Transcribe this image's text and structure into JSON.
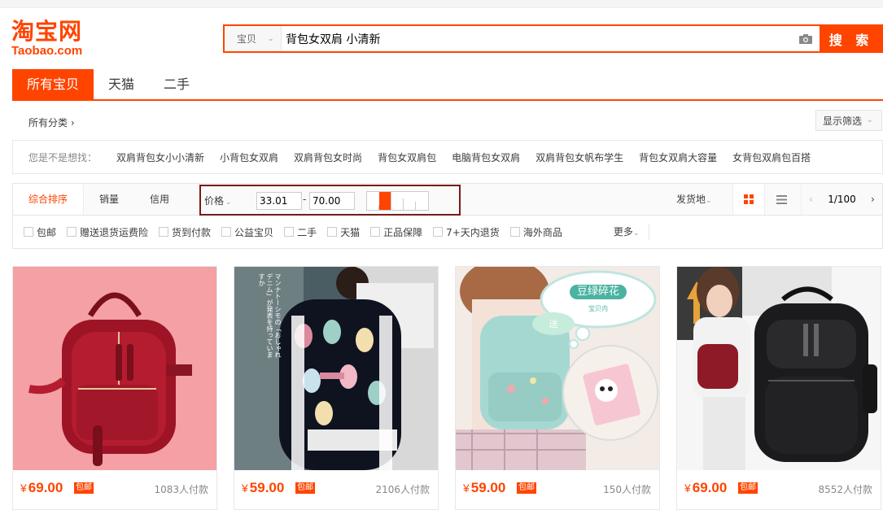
{
  "logo": {
    "cn": "淘宝网",
    "en": "Taobao.com"
  },
  "search": {
    "scope": "宝贝",
    "query": "背包女双肩 小清新",
    "button": "搜 索"
  },
  "tabs": [
    "所有宝贝",
    "天猫",
    "二手"
  ],
  "category": {
    "label": "所有分类 ›",
    "filter_button": "显示筛选"
  },
  "suggest": {
    "label": "您是不是想找：",
    "items": [
      "双肩背包女小小清新",
      "小背包女双肩",
      "双肩背包女时尚",
      "背包女双肩包",
      "电脑背包女双肩",
      "双肩背包女帆布学生",
      "背包女双肩大容量",
      "女背包双肩包百搭"
    ]
  },
  "sortbar": {
    "sorts": [
      "综合排序",
      "销量",
      "信用"
    ],
    "price_label": "价格",
    "price_min": "33.01",
    "price_max": "70.00",
    "price_dash": "-",
    "ship_from": "发货地",
    "page": "1/100"
  },
  "checks": [
    "包邮",
    "赠送退货运费险",
    "货到付款",
    "公益宝贝",
    "二手",
    "天猫",
    "正品保障",
    "7+天内退货",
    "海外商品"
  ],
  "more": "更多",
  "products": [
    {
      "price": "69.00",
      "badge": "包邮",
      "sold": "1083人付款",
      "currency": "¥"
    },
    {
      "price": "59.00",
      "badge": "包邮",
      "sold": "2106人付款",
      "currency": "¥"
    },
    {
      "price": "59.00",
      "badge": "包邮",
      "sold": "150人付款",
      "currency": "¥"
    },
    {
      "price": "69.00",
      "badge": "包邮",
      "sold": "8552人付款",
      "currency": "¥"
    }
  ],
  "product_images": {
    "p2_text": "マンナトーシモの「おしゃれデニム」が発表を持っていますか",
    "p3_bubble": "豆绿碎花",
    "p3_sub": "宝贝内",
    "p3_send": "送"
  },
  "colors": {
    "accent": "#ff4400",
    "highlight_box": "#7a1a1a"
  }
}
